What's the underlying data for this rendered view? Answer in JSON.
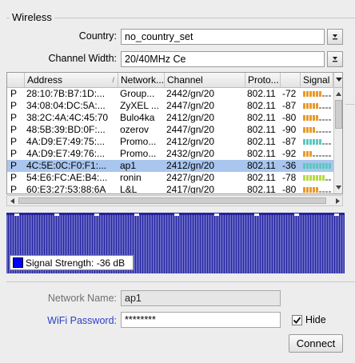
{
  "wireless": {
    "section_title": "Wireless",
    "country_label": "Country:",
    "country_value": "no_country_set",
    "channel_width_label": "Channel Width:",
    "channel_width_value": "20/40MHz Ce"
  },
  "table": {
    "columns": [
      "Address",
      "Network...",
      "Channel",
      "Proto...",
      "",
      "Signal"
    ],
    "rows": [
      {
        "flag": "P",
        "address": "28:10:7B:B7:1D:...",
        "network": "Group...",
        "channel": "2442/gn/20",
        "proto": "802.11",
        "signal": "-72",
        "bars": 6,
        "bar_color": "#e89a2c"
      },
      {
        "flag": "P",
        "address": "34:08:04:DC:5A:...",
        "network": "ZyXEL ...",
        "channel": "2447/gn/20",
        "proto": "802.11",
        "signal": "-87",
        "bars": 5,
        "bar_color": "#e89a2c"
      },
      {
        "flag": "P",
        "address": "38:2C:4A:4C:45:70",
        "network": "Bulo4ka",
        "channel": "2412/gn/20",
        "proto": "802.11",
        "signal": "-80",
        "bars": 5,
        "bar_color": "#e89a2c"
      },
      {
        "flag": "P",
        "address": "48:5B:39:BD:0F:...",
        "network": "ozerov",
        "channel": "2447/gn/20",
        "proto": "802.11",
        "signal": "-90",
        "bars": 4,
        "bar_color": "#e89a2c"
      },
      {
        "flag": "P",
        "address": "4A:D9:E7:49:75:...",
        "network": "Promo...",
        "channel": "2412/gn/20",
        "proto": "802.11",
        "signal": "-87",
        "bars": 6,
        "bar_color": "#5cc8c0"
      },
      {
        "flag": "P",
        "address": "4A:D9:E7:49:76:...",
        "network": "Promo...",
        "channel": "2432/gn/20",
        "proto": "802.11",
        "signal": "-92",
        "bars": 3,
        "bar_color": "#e89a2c"
      },
      {
        "flag": "P",
        "address": "4C:5E:0C:F0:F1:...",
        "network": "ap1",
        "channel": "2412/gn/20",
        "proto": "802.11",
        "signal": "-36",
        "bars": 9,
        "bar_color": "#5cc8c0"
      },
      {
        "flag": "P",
        "address": "54:E6:FC:AE:B4:...",
        "network": "ronin",
        "channel": "2427/gn/20",
        "proto": "802.11",
        "signal": "-78",
        "bars": 7,
        "bar_color": "#b8d848"
      },
      {
        "flag": "P",
        "address": "60:E3:27:53:88:6A",
        "network": "L&L",
        "channel": "2417/gn/20",
        "proto": "802.11",
        "signal": "-80",
        "bars": 5,
        "bar_color": "#e89a2c"
      }
    ],
    "selected_index": 6
  },
  "spectrum": {
    "legend_label": "Signal Strength:",
    "legend_value": "-36 dB",
    "legend_color": "#0000ff"
  },
  "form": {
    "network_name_label": "Network Name:",
    "network_name_value": "ap1",
    "wifi_password_label": "WiFi Password:",
    "wifi_password_value": "********",
    "hide_label": "Hide",
    "hide_checked": true,
    "connect_label": "Connect"
  },
  "icons": {
    "dropdown": "chevron-down-icon",
    "sort": "sort-icon",
    "check": "checkmark-icon"
  }
}
